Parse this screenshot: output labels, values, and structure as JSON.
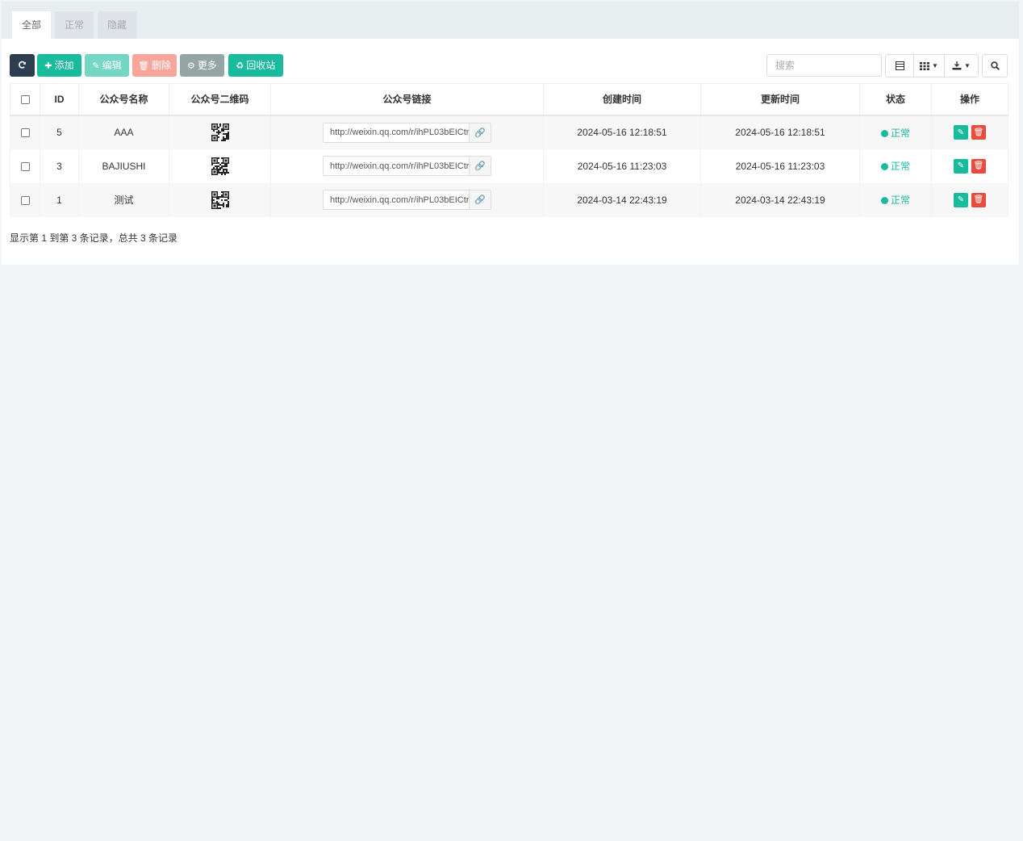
{
  "tabs": [
    {
      "label": "全部",
      "active": true
    },
    {
      "label": "正常",
      "active": false
    },
    {
      "label": "隐藏",
      "active": false
    }
  ],
  "toolbar": {
    "refresh_icon": "refresh-icon",
    "add_label": "添加",
    "edit_label": "编辑",
    "delete_label": "删除",
    "more_label": "更多",
    "recycle_label": "回收站"
  },
  "search": {
    "placeholder": "搜索"
  },
  "table": {
    "headers": {
      "id": "ID",
      "name": "公众号名称",
      "qrcode": "公众号二维码",
      "link": "公众号链接",
      "created": "创建时间",
      "updated": "更新时间",
      "status": "状态",
      "ops": "操作"
    },
    "rows": [
      {
        "id": "5",
        "name": "AAA",
        "link": "http://weixin.qq.com/r/ihPL03bEICtr",
        "created": "2024-05-16 12:18:51",
        "updated": "2024-05-16 12:18:51",
        "status": "正常"
      },
      {
        "id": "3",
        "name": "BAJIUSHI",
        "link": "http://weixin.qq.com/r/ihPL03bEICtr",
        "created": "2024-05-16 11:23:03",
        "updated": "2024-05-16 11:23:03",
        "status": "正常"
      },
      {
        "id": "1",
        "name": "测试",
        "link": "http://weixin.qq.com/r/ihPL03bEICtr",
        "created": "2024-03-14 22:43:19",
        "updated": "2024-03-14 22:43:19",
        "status": "正常"
      }
    ]
  },
  "footer": {
    "summary": "显示第 1 到第 3 条记录，总共 3 条记录"
  },
  "colors": {
    "primary": "#18bc9c",
    "danger": "#e74c3c",
    "dark": "#2c3e50"
  }
}
